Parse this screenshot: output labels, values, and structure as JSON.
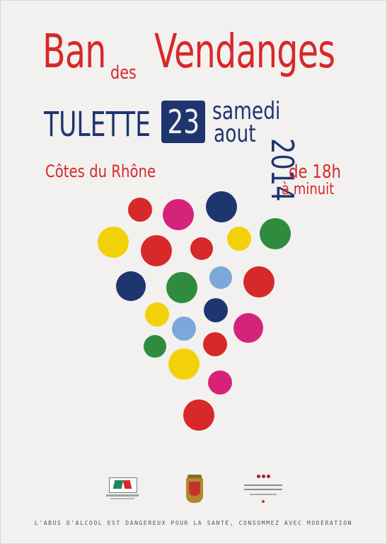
{
  "title": {
    "ban": "Ban",
    "des": "des",
    "vendanges": "Vendanges"
  },
  "event": {
    "village": "TULETTE",
    "day_number": "23",
    "weekday": "samedi",
    "month": "aout",
    "year": "2014",
    "region": "Côtes du Rhône",
    "start_time": "de 18h",
    "end_time": "à minuit"
  },
  "grape_dots": [
    {
      "color": "#d7282a"
    },
    {
      "color": "#d6237a"
    },
    {
      "color": "#1f3570"
    },
    {
      "color": "#f2d108"
    },
    {
      "color": "#d7282a"
    },
    {
      "color": "#d7282a"
    },
    {
      "color": "#f2d108"
    },
    {
      "color": "#2f8b3e"
    },
    {
      "color": "#1f3570"
    },
    {
      "color": "#2f8b3e"
    },
    {
      "color": "#7ba7db"
    },
    {
      "color": "#d7282a"
    },
    {
      "color": "#f2d108"
    },
    {
      "color": "#1f3570"
    },
    {
      "color": "#7ba7db"
    },
    {
      "color": "#d6237a"
    },
    {
      "color": "#2f8b3e"
    },
    {
      "color": "#d7282a"
    },
    {
      "color": "#f2d108"
    },
    {
      "color": "#d6237a"
    },
    {
      "color": "#d7282a"
    }
  ],
  "footer": {
    "disclaimer": "L'ABUS D'ALCOOL EST DANGEREUX POUR LA SANTÉ, CONSOMMEZ AVEC MODÉRATION"
  },
  "colors": {
    "red": "#d7282a",
    "navy": "#1f3570",
    "background": "#f2f1ef"
  },
  "sponsor_logos": [
    "credit-agricole-logo",
    "tulette-crest-logo",
    "syndicat-vignerons-logo"
  ]
}
